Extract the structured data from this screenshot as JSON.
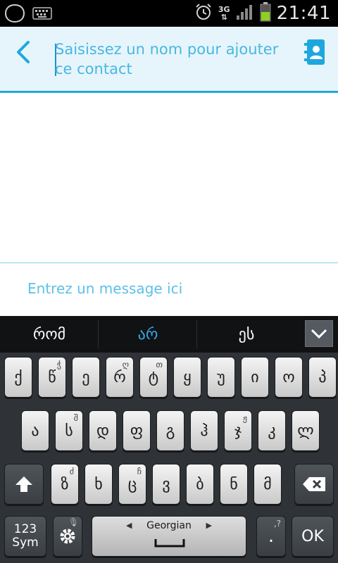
{
  "status_bar": {
    "time": "21:41",
    "network": "3G",
    "icons": [
      "chaton-icon",
      "keyboard-icon",
      "alarm-icon",
      "signal-icon",
      "battery-icon"
    ]
  },
  "header": {
    "recipient_placeholder": "Saisissez un nom pour ajouter ce contact",
    "back_icon": "chevron-left-icon",
    "contacts_icon": "contacts-book-icon"
  },
  "compose": {
    "placeholder": "Entrez un message ici"
  },
  "keyboard": {
    "suggestions": [
      "რომ",
      "არ",
      "ეს"
    ],
    "highlighted_suggestion_index": 1,
    "row1": [
      {
        "label": "ქ",
        "hint": ""
      },
      {
        "label": "წ",
        "hint": "ჭ"
      },
      {
        "label": "ე",
        "hint": ""
      },
      {
        "label": "რ",
        "hint": "ღ"
      },
      {
        "label": "ტ",
        "hint": "თ"
      },
      {
        "label": "ყ",
        "hint": ""
      },
      {
        "label": "უ",
        "hint": ""
      },
      {
        "label": "ი",
        "hint": ""
      },
      {
        "label": "ო",
        "hint": ""
      },
      {
        "label": "პ",
        "hint": ""
      }
    ],
    "row2": [
      {
        "label": "ა",
        "hint": ""
      },
      {
        "label": "ს",
        "hint": "შ"
      },
      {
        "label": "დ",
        "hint": ""
      },
      {
        "label": "ფ",
        "hint": ""
      },
      {
        "label": "გ",
        "hint": ""
      },
      {
        "label": "ჰ",
        "hint": ""
      },
      {
        "label": "ჯ",
        "hint": "ჟ"
      },
      {
        "label": "კ",
        "hint": ""
      },
      {
        "label": "ლ",
        "hint": ""
      }
    ],
    "row3": [
      {
        "label": "ზ",
        "hint": "ძ"
      },
      {
        "label": "ხ",
        "hint": ""
      },
      {
        "label": "ც",
        "hint": "ჩ"
      },
      {
        "label": "ვ",
        "hint": ""
      },
      {
        "label": "ბ",
        "hint": ""
      },
      {
        "label": "ნ",
        "hint": ""
      },
      {
        "label": "მ",
        "hint": ""
      }
    ],
    "sym_label_top": "123",
    "sym_label_bottom": "Sym",
    "space_label": "Georgian",
    "period_label": ".",
    "period_hint": ",?",
    "ok_label": "OK"
  },
  "colors": {
    "accent": "#1ea7df",
    "header_bg": "#e6f5fb",
    "placeholder": "#49b7e3",
    "keyboard_bg": "#2f3337"
  }
}
